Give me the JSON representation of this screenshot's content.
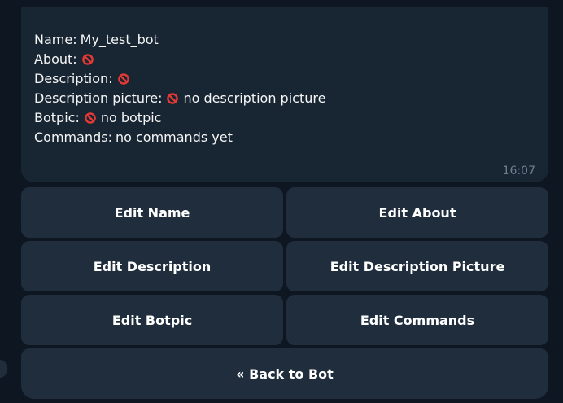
{
  "message": {
    "lines": [
      {
        "label": "Name:",
        "value": "My_test_bot",
        "icon": ""
      },
      {
        "label": "About:",
        "value": "",
        "icon": "no-entry-icon"
      },
      {
        "label": "Description:",
        "value": "",
        "icon": "no-entry-icon"
      },
      {
        "label": "Description picture:",
        "value": "no description picture",
        "icon": "no-entry-icon"
      },
      {
        "label": "Botpic:",
        "value": "no botpic",
        "icon": "no-entry-icon"
      },
      {
        "label": "Commands:",
        "value": "no commands yet",
        "icon": ""
      }
    ],
    "time": "16:07"
  },
  "keyboard": {
    "edit_name": "Edit Name",
    "edit_about": "Edit About",
    "edit_description": "Edit Description",
    "edit_description_picture": "Edit Description Picture",
    "edit_botpic": "Edit Botpic",
    "edit_commands": "Edit Commands",
    "back_to_bot": "« Back to Bot"
  },
  "colors": {
    "background": "#0e1621",
    "bubble": "#182533",
    "button": "#1f2d3d",
    "no_entry_red": "#e53935",
    "time": "#6d7f8f"
  }
}
